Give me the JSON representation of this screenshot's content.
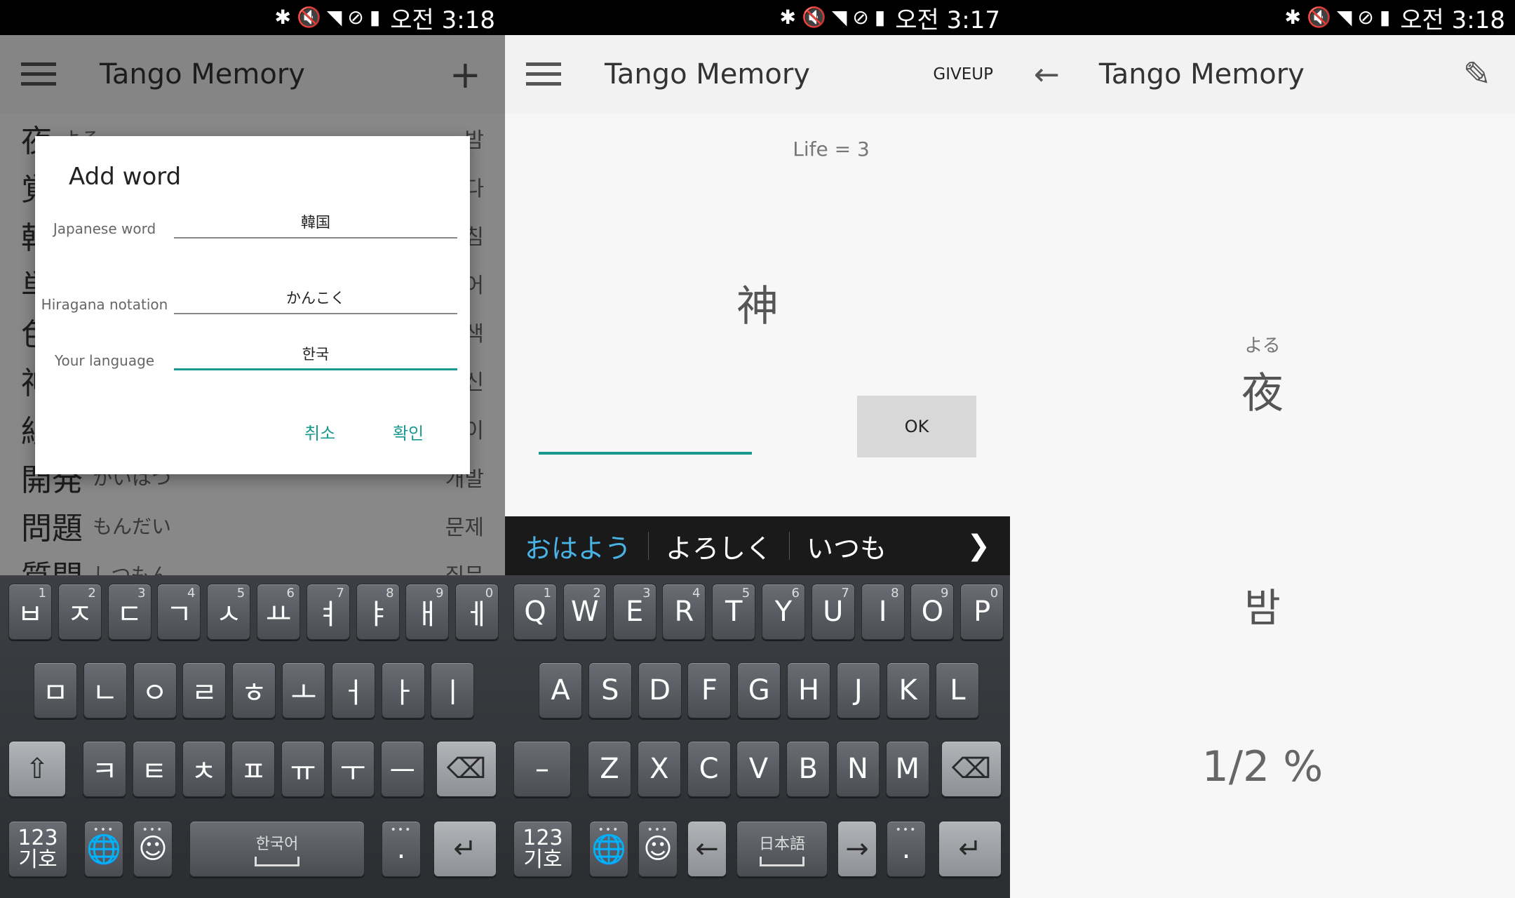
{
  "status_bar": {
    "time_left": "오전 3:18",
    "time_middle": "오전 3:17",
    "time_right": "오전 3:18"
  },
  "app": {
    "title": "Tango Memory"
  },
  "word_list": [
    {
      "kanji": "夜",
      "kana": "よる",
      "meaning": "밤"
    },
    {
      "kanji": "覚",
      "kana": "",
      "meaning": "다"
    },
    {
      "kanji": "韓",
      "kana": "",
      "meaning": "침"
    },
    {
      "kanji": "単",
      "kana": "",
      "meaning": "어"
    },
    {
      "kanji": "色",
      "kana": "",
      "meaning": "색"
    },
    {
      "kanji": "神",
      "kana": "",
      "meaning": "신"
    },
    {
      "kanji": "紙",
      "kana": "",
      "meaning": "이"
    },
    {
      "kanji": "開発",
      "kana": "かいはつ",
      "meaning": "개발"
    },
    {
      "kanji": "問題",
      "kana": "もんだい",
      "meaning": "문제"
    },
    {
      "kanji": "質問",
      "kana": "しつもん",
      "meaning": "질문"
    }
  ],
  "add_dialog": {
    "title": "Add word",
    "japanese_label": "Japanese word",
    "japanese_value": "韓国",
    "hiragana_label": "Hiragana notation",
    "hiragana_value": "かんこく",
    "language_label": "Your language",
    "language_value": "한국",
    "cancel_label": "취소",
    "confirm_label": "확인"
  },
  "keyboard_korean": {
    "row1": [
      "ㅂ",
      "ㅈ",
      "ㄷ",
      "ㄱ",
      "ㅅ",
      "ㅛ",
      "ㅕ",
      "ㅑ",
      "ㅐ",
      "ㅔ"
    ],
    "row1_nums": [
      "1",
      "2",
      "3",
      "4",
      "5",
      "6",
      "7",
      "8",
      "9",
      "0"
    ],
    "row2": [
      "ㅁ",
      "ㄴ",
      "ㅇ",
      "ㄹ",
      "ㅎ",
      "ㅗ",
      "ㅓ",
      "ㅏ",
      "ㅣ"
    ],
    "row3": [
      "ㅋ",
      "ㅌ",
      "ㅊ",
      "ㅍ",
      "ㅠ",
      "ㅜ",
      "ㅡ"
    ],
    "sym_label": "123\n기호",
    "space_label": "한국어",
    "period": "."
  },
  "quiz": {
    "giveup_label": "GIVEUP",
    "life_text": "Life = 3",
    "question": "神",
    "ok_label": "OK",
    "suggestions": [
      "おはよう",
      "よろしく",
      "いつも"
    ]
  },
  "keyboard_english": {
    "row1": [
      "Q",
      "W",
      "E",
      "R",
      "T",
      "Y",
      "U",
      "I",
      "O",
      "P"
    ],
    "row1_nums": [
      "1",
      "2",
      "3",
      "4",
      "5",
      "6",
      "7",
      "8",
      "9",
      "0"
    ],
    "row2": [
      "A",
      "S",
      "D",
      "F",
      "G",
      "H",
      "J",
      "K",
      "L"
    ],
    "row3": [
      "Z",
      "X",
      "C",
      "V",
      "B",
      "N",
      "M"
    ],
    "dash": "–",
    "sym_label": "123\n기호",
    "space_label": "日本語",
    "period": "."
  },
  "flashcard": {
    "ruby": "よる",
    "word": "夜",
    "meaning": "밤",
    "progress": "1/2 %"
  }
}
